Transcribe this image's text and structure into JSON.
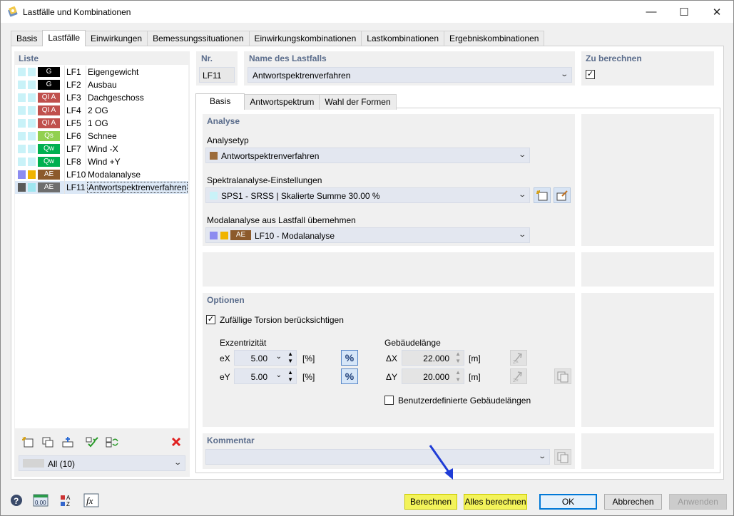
{
  "window": {
    "title": "Lastfälle und Kombinationen",
    "min": "—",
    "max": "☐",
    "close": "✕"
  },
  "tabs": [
    {
      "label": "Basis"
    },
    {
      "label": "Lastfälle",
      "active": true
    },
    {
      "label": "Einwirkungen"
    },
    {
      "label": "Bemessungssituationen"
    },
    {
      "label": "Einwirkungskombinationen"
    },
    {
      "label": "Lastkombinationen"
    },
    {
      "label": "Ergebniskombinationen"
    }
  ],
  "list": {
    "label": "Liste",
    "items": [
      {
        "code": "LF1",
        "name": "Eigengewicht",
        "badge": "G",
        "badge_color": "#000000",
        "sw1": "#c9f2f8",
        "sw2": "#c9f2f8"
      },
      {
        "code": "LF2",
        "name": "Ausbau",
        "badge": "G",
        "badge_color": "#000000",
        "sw1": "#c9f2f8",
        "sw2": "#c9f2f8"
      },
      {
        "code": "LF3",
        "name": "Dachgeschoss",
        "badge": "QI A",
        "badge_color": "#c0504d",
        "sw1": "#c9f2f8",
        "sw2": "#c9f2f8"
      },
      {
        "code": "LF4",
        "name": "2 OG",
        "badge": "QI A",
        "badge_color": "#c0504d",
        "sw1": "#c9f2f8",
        "sw2": "#c9f2f8"
      },
      {
        "code": "LF5",
        "name": "1 OG",
        "badge": "QI A",
        "badge_color": "#c0504d",
        "sw1": "#c9f2f8",
        "sw2": "#c9f2f8"
      },
      {
        "code": "LF6",
        "name": "Schnee",
        "badge": "Qs",
        "badge_color": "#92d050",
        "sw1": "#c9f2f8",
        "sw2": "#c9f2f8"
      },
      {
        "code": "LF7",
        "name": "Wind -X",
        "badge": "Qw",
        "badge_color": "#00b050",
        "sw1": "#c9f2f8",
        "sw2": "#c9f2f8"
      },
      {
        "code": "LF8",
        "name": "Wind +Y",
        "badge": "Qw",
        "badge_color": "#00b050",
        "sw1": "#c9f2f8",
        "sw2": "#c9f2f8"
      },
      {
        "code": "LF10",
        "name": "Modalanalyse",
        "badge": "AE",
        "badge_color": "#8c5a2b",
        "sw1": "#8c8cf0",
        "sw2": "#f0b400"
      },
      {
        "code": "LF11",
        "name": "Antwortspektrenverfahren",
        "badge": "AE",
        "badge_color": "#6e6e6e",
        "sw1": "#5a5a5a",
        "sw2": "#9fe6f0",
        "selected": true
      }
    ],
    "filter": "All (10)"
  },
  "header": {
    "nr_label": "Nr.",
    "nr_value": "LF11",
    "name_label": "Name des Lastfalls",
    "name_value": "Antwortspektrenverfahren",
    "calc_label": "Zu berechnen",
    "calc_checked": "✓"
  },
  "subtabs": [
    {
      "label": "Basis",
      "active": true
    },
    {
      "label": "Antwortspektrum"
    },
    {
      "label": "Wahl der Formen"
    }
  ],
  "analyse": {
    "label": "Analyse",
    "typ_label": "Analysetyp",
    "typ_value": "Antwortspektrenverfahren",
    "typ_color": "#9c6b3a",
    "spektral_label": "Spektralanalyse-Einstellungen",
    "spektral_value": "SPS1 - SRSS | Skalierte Summe 30.00 %",
    "spektral_color": "#c9f2f8",
    "modal_label": "Modalanalyse aus Lastfall übernehmen",
    "modal_badge": "AE",
    "modal_value": "LF10 - Modalanalyse"
  },
  "optionen": {
    "label": "Optionen",
    "torsion_label": "Zufällige Torsion berücksichtigen",
    "torsion_checked": "✓",
    "exz_label": "Exzentrizität",
    "ex_label": "eX",
    "ex_value": "5.00",
    "ey_label": "eY",
    "ey_value": "5.00",
    "pct_unit": "[%]",
    "pct_btn": "%",
    "geb_label": "Gebäudelänge",
    "dx_label": "ΔX",
    "dx_value": "22.000",
    "dy_label": "ΔY",
    "dy_value": "20.000",
    "m_unit": "[m]",
    "benutzer_label": "Benutzerdefinierte Gebäudelängen"
  },
  "kommentar": {
    "label": "Kommentar"
  },
  "buttons": {
    "berechnen": "Berechnen",
    "alles": "Alles berechnen",
    "ok": "OK",
    "abbrechen": "Abbrechen",
    "anwenden": "Anwenden"
  }
}
